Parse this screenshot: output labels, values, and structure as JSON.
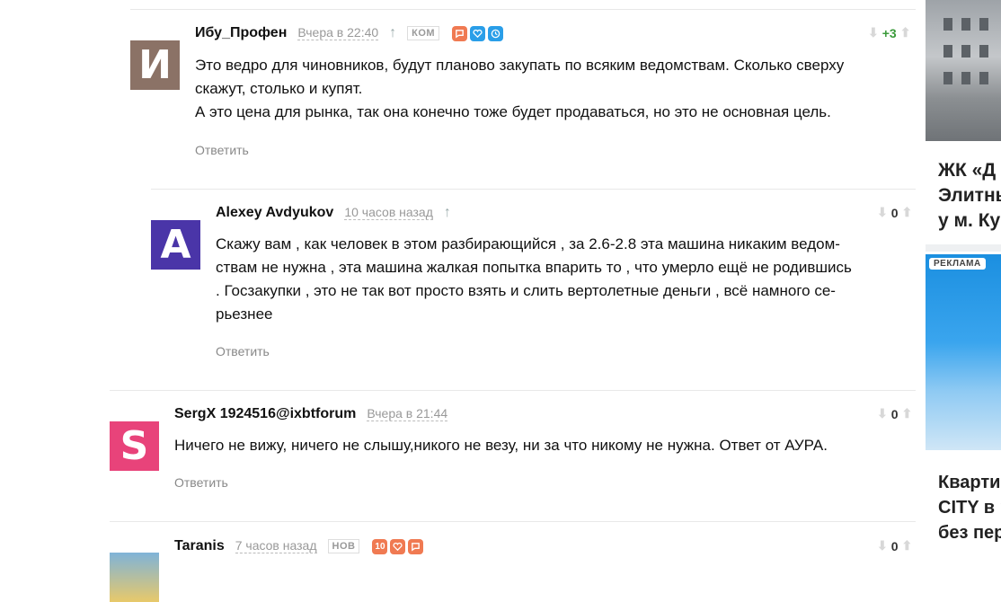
{
  "comments": [
    {
      "author": "Ибу_Профен",
      "avatar_letter": "И",
      "avatar_color": "#8b7266",
      "time": "Вчера в 22:40",
      "up_arrow": "↑",
      "tag": "КОМ",
      "badges": [
        "comment-icon",
        "heart-icon",
        "clock-icon"
      ],
      "text_lines": [
        "Это ведро для чиновников, будут планово закупать по всяким ведомствам. Сколько сверху",
        "скажут, столько и купят.",
        "А это цена для рынка, так она конечно тоже будет продаваться, но это не основная цель."
      ],
      "reply": "Ответить",
      "score": "+3",
      "score_color": "#3a9a3a"
    },
    {
      "author": "Alexey Avdyukov",
      "avatar_letter": "A",
      "avatar_color": "#4a35a8",
      "time": "10 часов назад",
      "up_arrow": "↑",
      "text_lines": [
        "Скажу вам , как человек в этом разбирающийся , за 2.6-2.8 эта машина никаким ведом-",
        "ствам не нужна , эта машина жалкая попытка впарить то , что умерло ещё не родившись",
        ". Госзакупки , это не так вот просто взять и слить вертолетные деньги , всё намного се-",
        "рьезнее"
      ],
      "reply": "Ответить",
      "score": "0",
      "score_color": "#333"
    },
    {
      "author": "SergX 1924516@ixbtforum",
      "avatar_letter": "S",
      "avatar_color": "#e8437a",
      "time": "Вчера в 21:44",
      "text_lines": [
        "Ничего не вижу, ничего не слышу,никого не везу, ни за что никому не нужна. Ответ от АУРА."
      ],
      "reply": "Ответить",
      "score": "0",
      "score_color": "#333"
    },
    {
      "author": "Taranis",
      "time": "7 часов назад",
      "tag": "НОВ",
      "badge_number": "10",
      "badges": [
        "heart-icon",
        "comment-icon"
      ],
      "score": "0",
      "score_color": "#333"
    }
  ],
  "sidebar": {
    "block1_lines": [
      "ЖК «Д",
      "Элитны",
      "у м. Ку"
    ],
    "ad_label": "РЕКЛАМА",
    "block2_lines": [
      "Кварти",
      "CITY в р",
      "без пер"
    ]
  },
  "colors": {
    "badge_orange": "#f07a52",
    "badge_blue": "#2a9ee8",
    "vote_arrow": "#d0d0d0"
  }
}
